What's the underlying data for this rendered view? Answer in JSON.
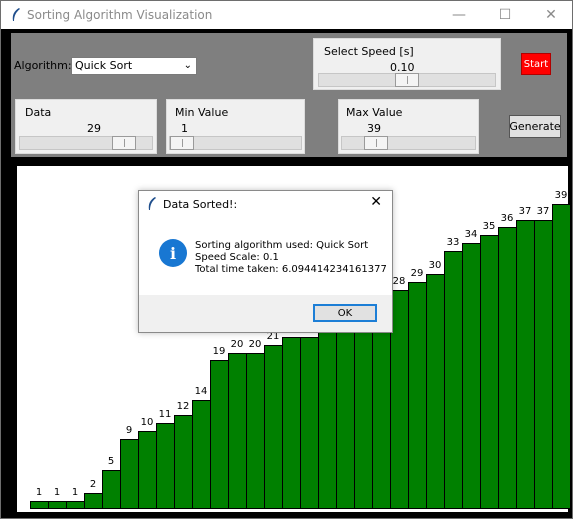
{
  "window": {
    "title": "Sorting Algorithm Visualization",
    "minimize_glyph": "—",
    "maximize_glyph": "☐",
    "close_glyph": "✕"
  },
  "controls": {
    "algorithm_label": "Algorithm:",
    "algorithm_value": "Quick Sort",
    "speed": {
      "title": "Select Speed [s]",
      "value": "0.10",
      "level": 0.5
    },
    "start_label": "Start",
    "data": {
      "title": "Data",
      "value": "29",
      "level": 0.85
    },
    "min": {
      "title": "Min Value",
      "value": "1",
      "level": 0.0
    },
    "max": {
      "title": "Max Value",
      "value": "39",
      "level": 0.2
    },
    "generate_label": "Generate",
    "accent_start": "#ff0000",
    "canvas_bg": "#7f7f7f"
  },
  "chart_data": {
    "type": "bar",
    "bar_color": "#008000",
    "values": [
      1,
      1,
      1,
      2,
      5,
      9,
      10,
      11,
      12,
      14,
      19,
      20,
      20,
      21,
      22,
      22,
      24,
      25,
      26,
      27,
      28,
      29,
      30,
      33,
      34,
      35,
      36,
      37,
      37,
      39
    ],
    "max": 39
  },
  "dialog": {
    "title": "Data Sorted!:",
    "close_glyph": "✕",
    "icon_glyph": "i",
    "line1": "Sorting algorithm used: Quick Sort",
    "line2": "Speed Scale: 0.1",
    "line3": "Total time taken: 6.094414234161377",
    "ok_label": "OK"
  }
}
